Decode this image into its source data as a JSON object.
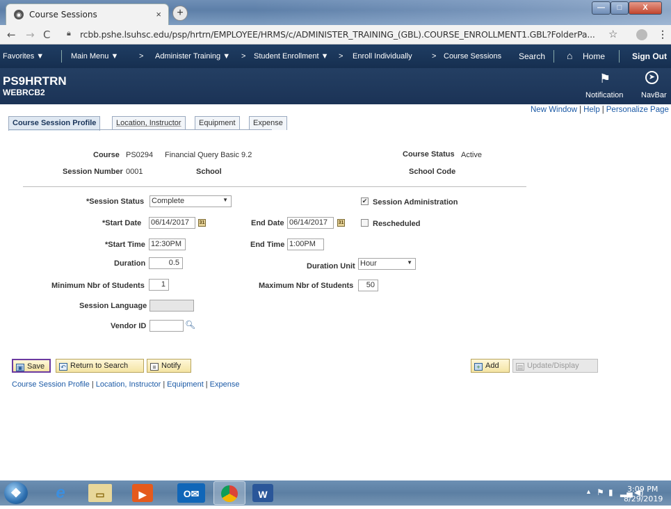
{
  "browser": {
    "tab_title": "Course Sessions",
    "tab_close": "×",
    "new_tab": "+",
    "url": "rcbb.pshe.lsuhsc.edu/psp/hrtrn/EMPLOYEE/HRMS/c/ADMINISTER_TRAINING_(GBL).COURSE_ENROLLMENT1.GBL?FolderPa...",
    "window_buttons": {
      "minimize": "—",
      "maximize": "□",
      "close": "X"
    }
  },
  "nav": {
    "favorites": "Favorites ▼",
    "main_menu": "Main Menu ▼",
    "crumb1": "Administer Training ▼",
    "crumb2": "Student Enrollment ▼",
    "crumb3": "Enroll Individually",
    "crumb4": "Course Sessions",
    "search": "Search",
    "home": "Home",
    "sign_out": "Sign Out",
    "separator": ">"
  },
  "header": {
    "database": "PS9HRTRN",
    "user": "WEBRCB2",
    "notification": "Notification",
    "navbar": "NavBar"
  },
  "page_links": {
    "new_window": "New Window",
    "help": "Help",
    "personalize": "Personalize Page"
  },
  "tabs": [
    "Course Session Profile",
    "Location, Instructor",
    "Equipment",
    "Expense"
  ],
  "form": {
    "course_label": "Course",
    "course_code": "PS0294",
    "course_name": "Financial Query Basic 9.2",
    "course_status_label": "Course Status",
    "course_status": "Active",
    "session_number_label": "Session Number",
    "session_number": "0001",
    "school_label": "School",
    "school_code_label": "School Code",
    "session_status_label": "*Session Status",
    "session_status": "Complete",
    "session_admin_label": "Session Administration",
    "session_admin_checked": true,
    "start_date_label": "*Start Date",
    "start_date": "06/14/2017",
    "end_date_label": "End Date",
    "end_date": "06/14/2017",
    "rescheduled_label": "Rescheduled",
    "start_time_label": "*Start Time",
    "start_time": "12:30PM",
    "end_time_label": "End Time",
    "end_time": "1:00PM",
    "duration_label": "Duration",
    "duration": "0.5",
    "duration_unit_label": "Duration Unit",
    "duration_unit": "Hour",
    "min_students_label": "Minimum Nbr of Students",
    "min_students": "1",
    "max_students_label": "Maximum Nbr of Students",
    "max_students": "50",
    "session_language_label": "Session Language",
    "session_language": "",
    "vendor_id_label": "Vendor ID",
    "vendor_id": ""
  },
  "buttons": {
    "save": "Save",
    "return_to_search": "Return to Search",
    "notify": "Notify",
    "add": "Add",
    "update_display": "Update/Display"
  },
  "bottom_links": [
    "Course Session Profile",
    "Location, Instructor",
    "Equipment",
    "Expense"
  ],
  "taskbar": {
    "time": "3:09 PM",
    "date": "8/29/2019"
  },
  "colors": {
    "ps_nav": "#1f3d63",
    "ps_header": "#243f63",
    "link": "#1c5aa6",
    "button": "#f4e4a4"
  }
}
